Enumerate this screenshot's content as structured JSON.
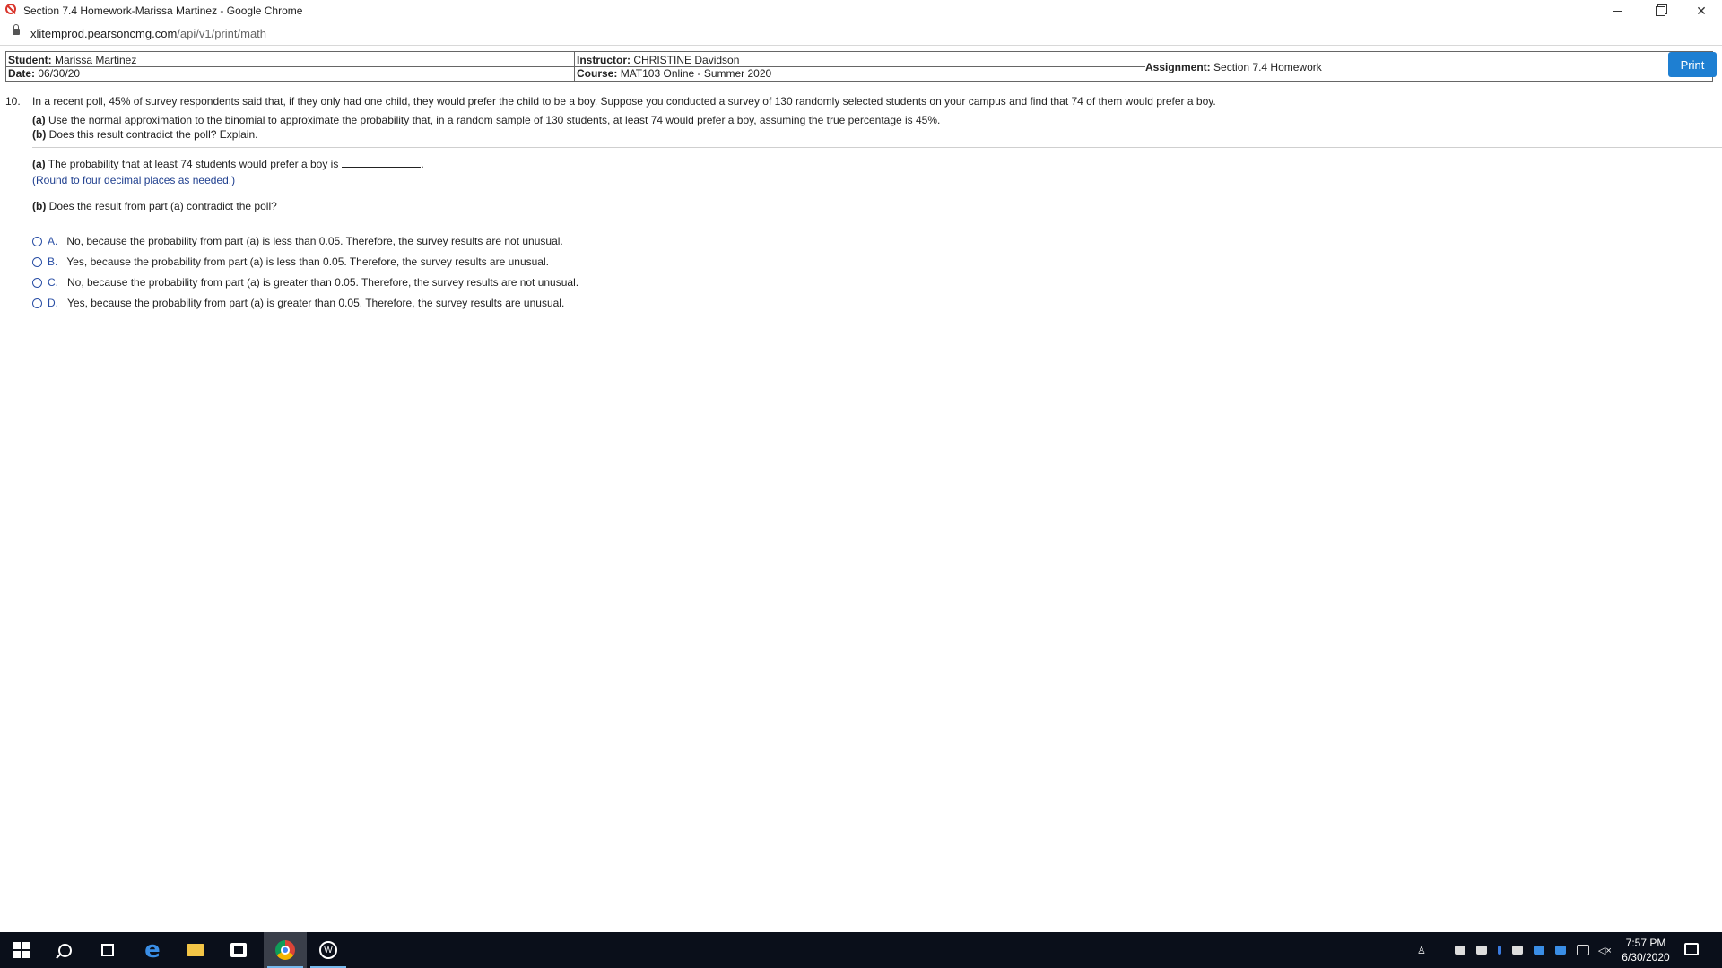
{
  "window": {
    "title": "Section 7.4 Homework-Marissa Martinez - Google Chrome",
    "url_domain": "xlitemprod.pearsoncmg.com",
    "url_path": "/api/v1/print/math"
  },
  "header": {
    "student_label": "Student:",
    "student_value": "Marissa Martinez",
    "date_label": "Date:",
    "date_value": "06/30/20",
    "instructor_label": "Instructor:",
    "instructor_value": "CHRISTINE Davidson",
    "course_label": "Course:",
    "course_value": "MAT103 Online - Summer 2020",
    "assignment_label": "Assignment:",
    "assignment_value": "Section 7.4 Homework",
    "print_label": "Print"
  },
  "question": {
    "number": "10.",
    "text": "In a recent poll, 45% of survey respondents said that, if they only had one child, they would prefer the child to be a boy. Suppose you conducted a survey of 130 randomly selected students on your campus and find that 74 of them would prefer a boy.",
    "part_a_label": "(a)",
    "part_a_text": "Use the normal approximation to the binomial to approximate the probability that, in a random sample of 130 students, at least 74 would prefer a boy, assuming the true percentage is 45%.",
    "part_b_label": "(b)",
    "part_b_text": "Does this result contradict the poll? Explain."
  },
  "answers": {
    "a_label": "(a)",
    "a_text": "The probability that at least 74 students would prefer a boy is",
    "a_value": "",
    "a_suffix": ".",
    "round_note": "(Round to four decimal places as needed.)",
    "b_label": "(b)",
    "b_text": "Does the result from part (a) contradict the poll?",
    "options": [
      {
        "letter": "A.",
        "text": "No, because the probability from part (a) is less than 0.05. Therefore, the survey results are not unusual."
      },
      {
        "letter": "B.",
        "text": "Yes, because the probability from part (a) is less than 0.05. Therefore, the survey results are unusual."
      },
      {
        "letter": "C.",
        "text": "No, because the probability from part (a) is greater than 0.05. Therefore, the survey results are not unusual."
      },
      {
        "letter": "D.",
        "text": "Yes, because the probability from part (a) is greater than 0.05. Therefore, the survey results are unusual."
      }
    ]
  },
  "taskbar": {
    "time": "7:57 PM",
    "date": "6/30/2020",
    "edge_letter": "e",
    "cw_letter": "W"
  }
}
